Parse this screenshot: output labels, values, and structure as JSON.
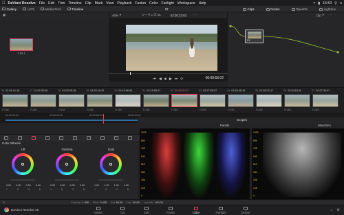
{
  "menubar": {
    "app": "DaVinci Resolve",
    "menus": [
      "File",
      "Edit",
      "Trim",
      "Timeline",
      "Clip",
      "Mark",
      "View",
      "Playback",
      "Fusion",
      "Color",
      "Fairlight",
      "Workspace",
      "Help"
    ],
    "clock": "16:53"
  },
  "toolbar": {
    "gallery": "Gallery",
    "luts": "LUTs",
    "media_pool": "Media Pool",
    "timeline": "Timeline",
    "project": "rtr",
    "clips": "Clips",
    "nodes": "Nodes",
    "openfx": "OpenFX",
    "lightbox": "Lightbox"
  },
  "viewer": {
    "zoom": "45%",
    "timeline_name": "シーケンス 01",
    "source_tc": "02:20:22:03",
    "mode": "Clip",
    "timecode": "00:00:56:02"
  },
  "gallery": {
    "still_label": "1.29.1"
  },
  "nodes": {
    "node_label": "01"
  },
  "clips": [
    {
      "num": "16",
      "tc": "01:51:41:18",
      "codec": "H.264"
    },
    {
      "num": "17",
      "tc": "01:52:25:06",
      "codec": "H.264"
    },
    {
      "num": "18",
      "tc": "01:53:09:18",
      "codec": "H.264"
    },
    {
      "num": "19",
      "tc": "01:53:16:22",
      "codec": "H.264"
    },
    {
      "num": "20",
      "tc": "02:10:06:06",
      "codec": "H.264"
    },
    {
      "num": "21",
      "tc": "02:15:55:07",
      "codec": "H.264"
    },
    {
      "num": "22",
      "tc": "02:20:21:07",
      "codec": "H.264",
      "selected": true
    },
    {
      "num": "23",
      "tc": "02:27:05:07",
      "codec": "H.264"
    },
    {
      "num": "24",
      "tc": "01:50:45:13",
      "codec": "H.264"
    },
    {
      "num": "25",
      "tc": "01:55:21:17",
      "codec": "H.264"
    },
    {
      "num": "26",
      "tc": "02:04:18:11",
      "codec": "H.264"
    },
    {
      "num": "27",
      "tc": "02:27:30:07",
      "codec": "H.264"
    }
  ],
  "minitl": {
    "t1": "00:00:00:00",
    "t2": "00:00:34:00",
    "t3": "00:00:54:20",
    "t4": "00:00:59:11"
  },
  "wheels": {
    "header": "Color Wheels",
    "items": [
      {
        "title": "Lift",
        "vals": [
          "0.00",
          "0.00",
          "0.00",
          "0.00"
        ],
        "keys": [
          "Y",
          "R",
          "G",
          "B"
        ]
      },
      {
        "title": "Gamma",
        "vals": [
          "0.00",
          "0.00",
          "0.00",
          "0.00"
        ],
        "keys": [
          "Y",
          "R",
          "G",
          "B"
        ]
      },
      {
        "title": "Gain",
        "vals": [
          "1.00",
          "1.00",
          "1.00",
          "1.00"
        ],
        "keys": [
          "Y",
          "R",
          "G",
          "B"
        ]
      }
    ]
  },
  "scopes": {
    "title": "Scopes",
    "parade": "Parade",
    "waveform": "Waveform",
    "scale": [
      "1023",
      "896",
      "768",
      "640",
      "512",
      "384",
      "256",
      "128",
      "0"
    ]
  },
  "status": {
    "contrast_label": "Contrast",
    "contrast": "1.000",
    "pivot_label": "Pivot",
    "pivot": "0.435",
    "sat_label": "Sat",
    "sat": "50.00",
    "hue_label": "Hue",
    "hue": "50.00",
    "lummix_label": "Lum Mix",
    "lummix": "100.00"
  },
  "pagenav": {
    "brand": "DaVinci Resolve 16",
    "pages": [
      "Media",
      "Cut",
      "Edit",
      "Fusion",
      "Color",
      "Fairlight",
      "Deliver"
    ],
    "active": "Color"
  },
  "colors": {
    "accent": "#e0445e",
    "scope_scale": "#d8c05a"
  }
}
